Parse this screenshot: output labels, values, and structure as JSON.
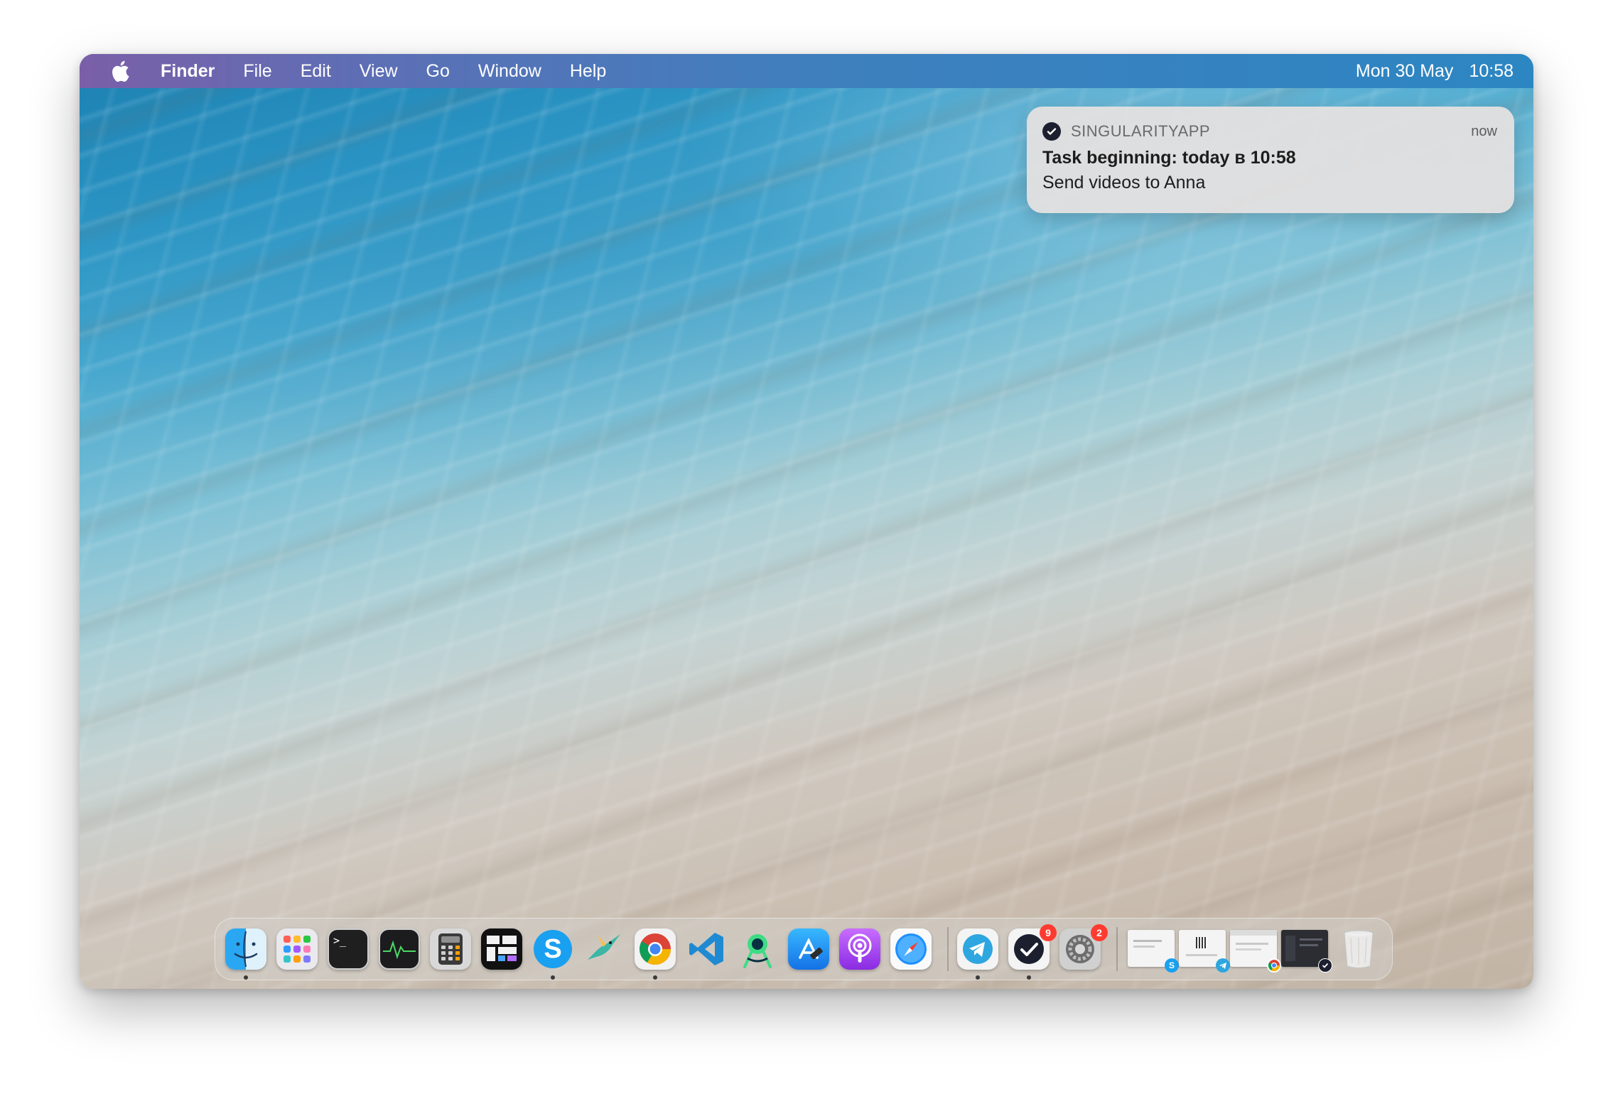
{
  "menubar": {
    "apple": "apple-icon",
    "items": [
      "Finder",
      "File",
      "Edit",
      "View",
      "Go",
      "Window",
      "Help"
    ],
    "date": "Mon 30 May",
    "time": "10:58"
  },
  "notification": {
    "app": "SINGULARITYAPP",
    "time": "now",
    "title": "Task beginning: today в 10:58",
    "body": "Send videos to Anna"
  },
  "dock": {
    "apps": [
      {
        "name": "finder",
        "icon": "finder-icon",
        "running": true
      },
      {
        "name": "launchpad",
        "icon": "launchpad-icon",
        "running": false
      },
      {
        "name": "terminal",
        "icon": "terminal-icon",
        "running": false,
        "glyph": ">_"
      },
      {
        "name": "activity-monitor",
        "icon": "activity-monitor-icon",
        "running": false
      },
      {
        "name": "calculator",
        "icon": "calculator-icon",
        "running": false
      },
      {
        "name": "mission-control",
        "icon": "mission-control-icon",
        "running": false
      },
      {
        "name": "skype",
        "icon": "skype-icon",
        "running": true,
        "glyph": "S"
      },
      {
        "name": "hummingbird",
        "icon": "hummingbird-icon",
        "running": false
      },
      {
        "name": "chrome",
        "icon": "chrome-icon",
        "running": true
      },
      {
        "name": "vscode",
        "icon": "vscode-icon",
        "running": false
      },
      {
        "name": "android-studio",
        "icon": "android-studio-icon",
        "running": false
      },
      {
        "name": "app-store",
        "icon": "app-store-icon",
        "running": false
      },
      {
        "name": "podcasts",
        "icon": "podcasts-icon",
        "running": false
      },
      {
        "name": "safari",
        "icon": "safari-icon",
        "running": false
      },
      {
        "name": "telegram",
        "icon": "telegram-icon",
        "running": true
      },
      {
        "name": "singularity",
        "icon": "singularity-icon",
        "running": true,
        "badge": "9"
      },
      {
        "name": "system-preferences",
        "icon": "system-preferences-icon",
        "running": false,
        "badge": "2"
      }
    ],
    "windows": [
      {
        "name": "minimized-skype-window",
        "badge_icon": "skype-icon",
        "badge_glyph": "S"
      },
      {
        "name": "minimized-telegram-window",
        "badge_icon": "telegram-icon"
      },
      {
        "name": "minimized-chrome-window",
        "badge_icon": "chrome-icon"
      },
      {
        "name": "minimized-singularity-window",
        "badge_icon": "singularity-icon"
      }
    ],
    "trash": "trash-icon"
  },
  "colors": {
    "menubar_start": "#7a5fa8",
    "menubar_end": "#2c86c2",
    "badge": "#ff3b30",
    "notification_bg": "#e2e0e0"
  }
}
